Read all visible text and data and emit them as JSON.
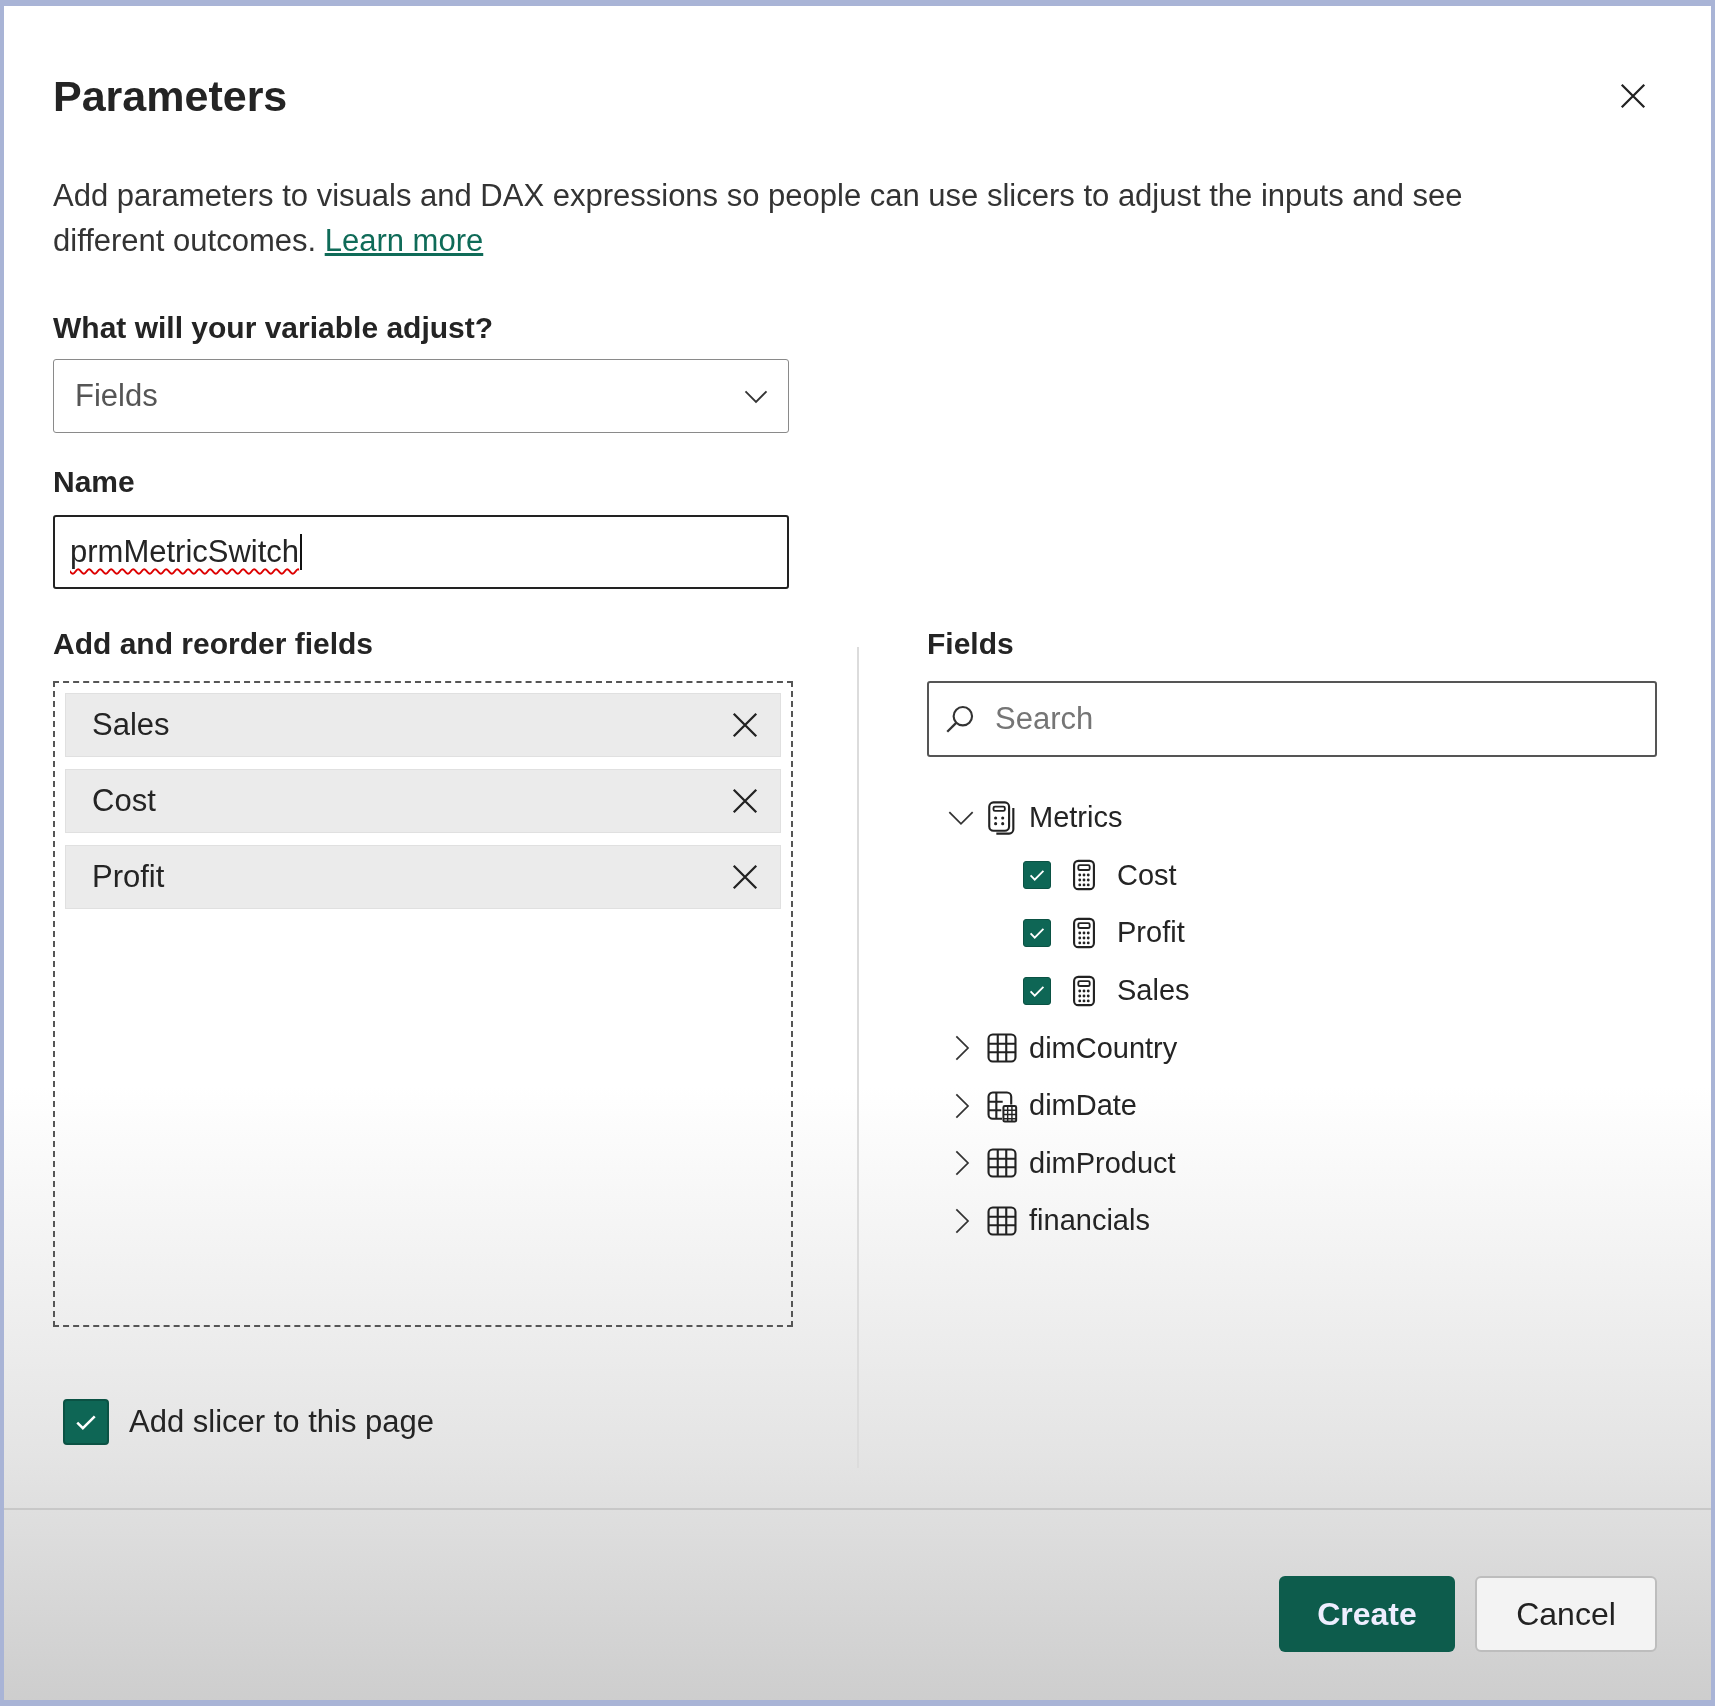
{
  "dialog": {
    "title": "Parameters",
    "description": "Add parameters to visuals and DAX expressions so people can use slicers to adjust the inputs and see different outcomes.",
    "learn_more": "Learn more"
  },
  "adjust": {
    "label": "What will your variable adjust?",
    "value": "Fields"
  },
  "name": {
    "label": "Name",
    "value": "prmMetricSwitch",
    "misspelled": true
  },
  "selected_fields": {
    "label": "Add and reorder fields",
    "items": [
      "Sales",
      "Cost",
      "Profit"
    ]
  },
  "fields": {
    "label": "Fields",
    "search": {
      "placeholder": "Search"
    },
    "tree": [
      {
        "label": "Metrics",
        "kind": "measure-group",
        "expanded": true,
        "children": [
          {
            "label": "Cost",
            "kind": "measure",
            "checked": true
          },
          {
            "label": "Profit",
            "kind": "measure",
            "checked": true
          },
          {
            "label": "Sales",
            "kind": "measure",
            "checked": true
          }
        ]
      },
      {
        "label": "dimCountry",
        "kind": "table",
        "expanded": false
      },
      {
        "label": "dimDate",
        "kind": "date-table",
        "expanded": false
      },
      {
        "label": "dimProduct",
        "kind": "table",
        "expanded": false
      },
      {
        "label": "financials",
        "kind": "table",
        "expanded": false
      }
    ]
  },
  "add_slicer": {
    "label": "Add slicer to this page",
    "checked": true
  },
  "buttons": [
    {
      "label": "Create",
      "kind": "primary"
    },
    {
      "label": "Cancel",
      "kind": "secondary"
    }
  ]
}
